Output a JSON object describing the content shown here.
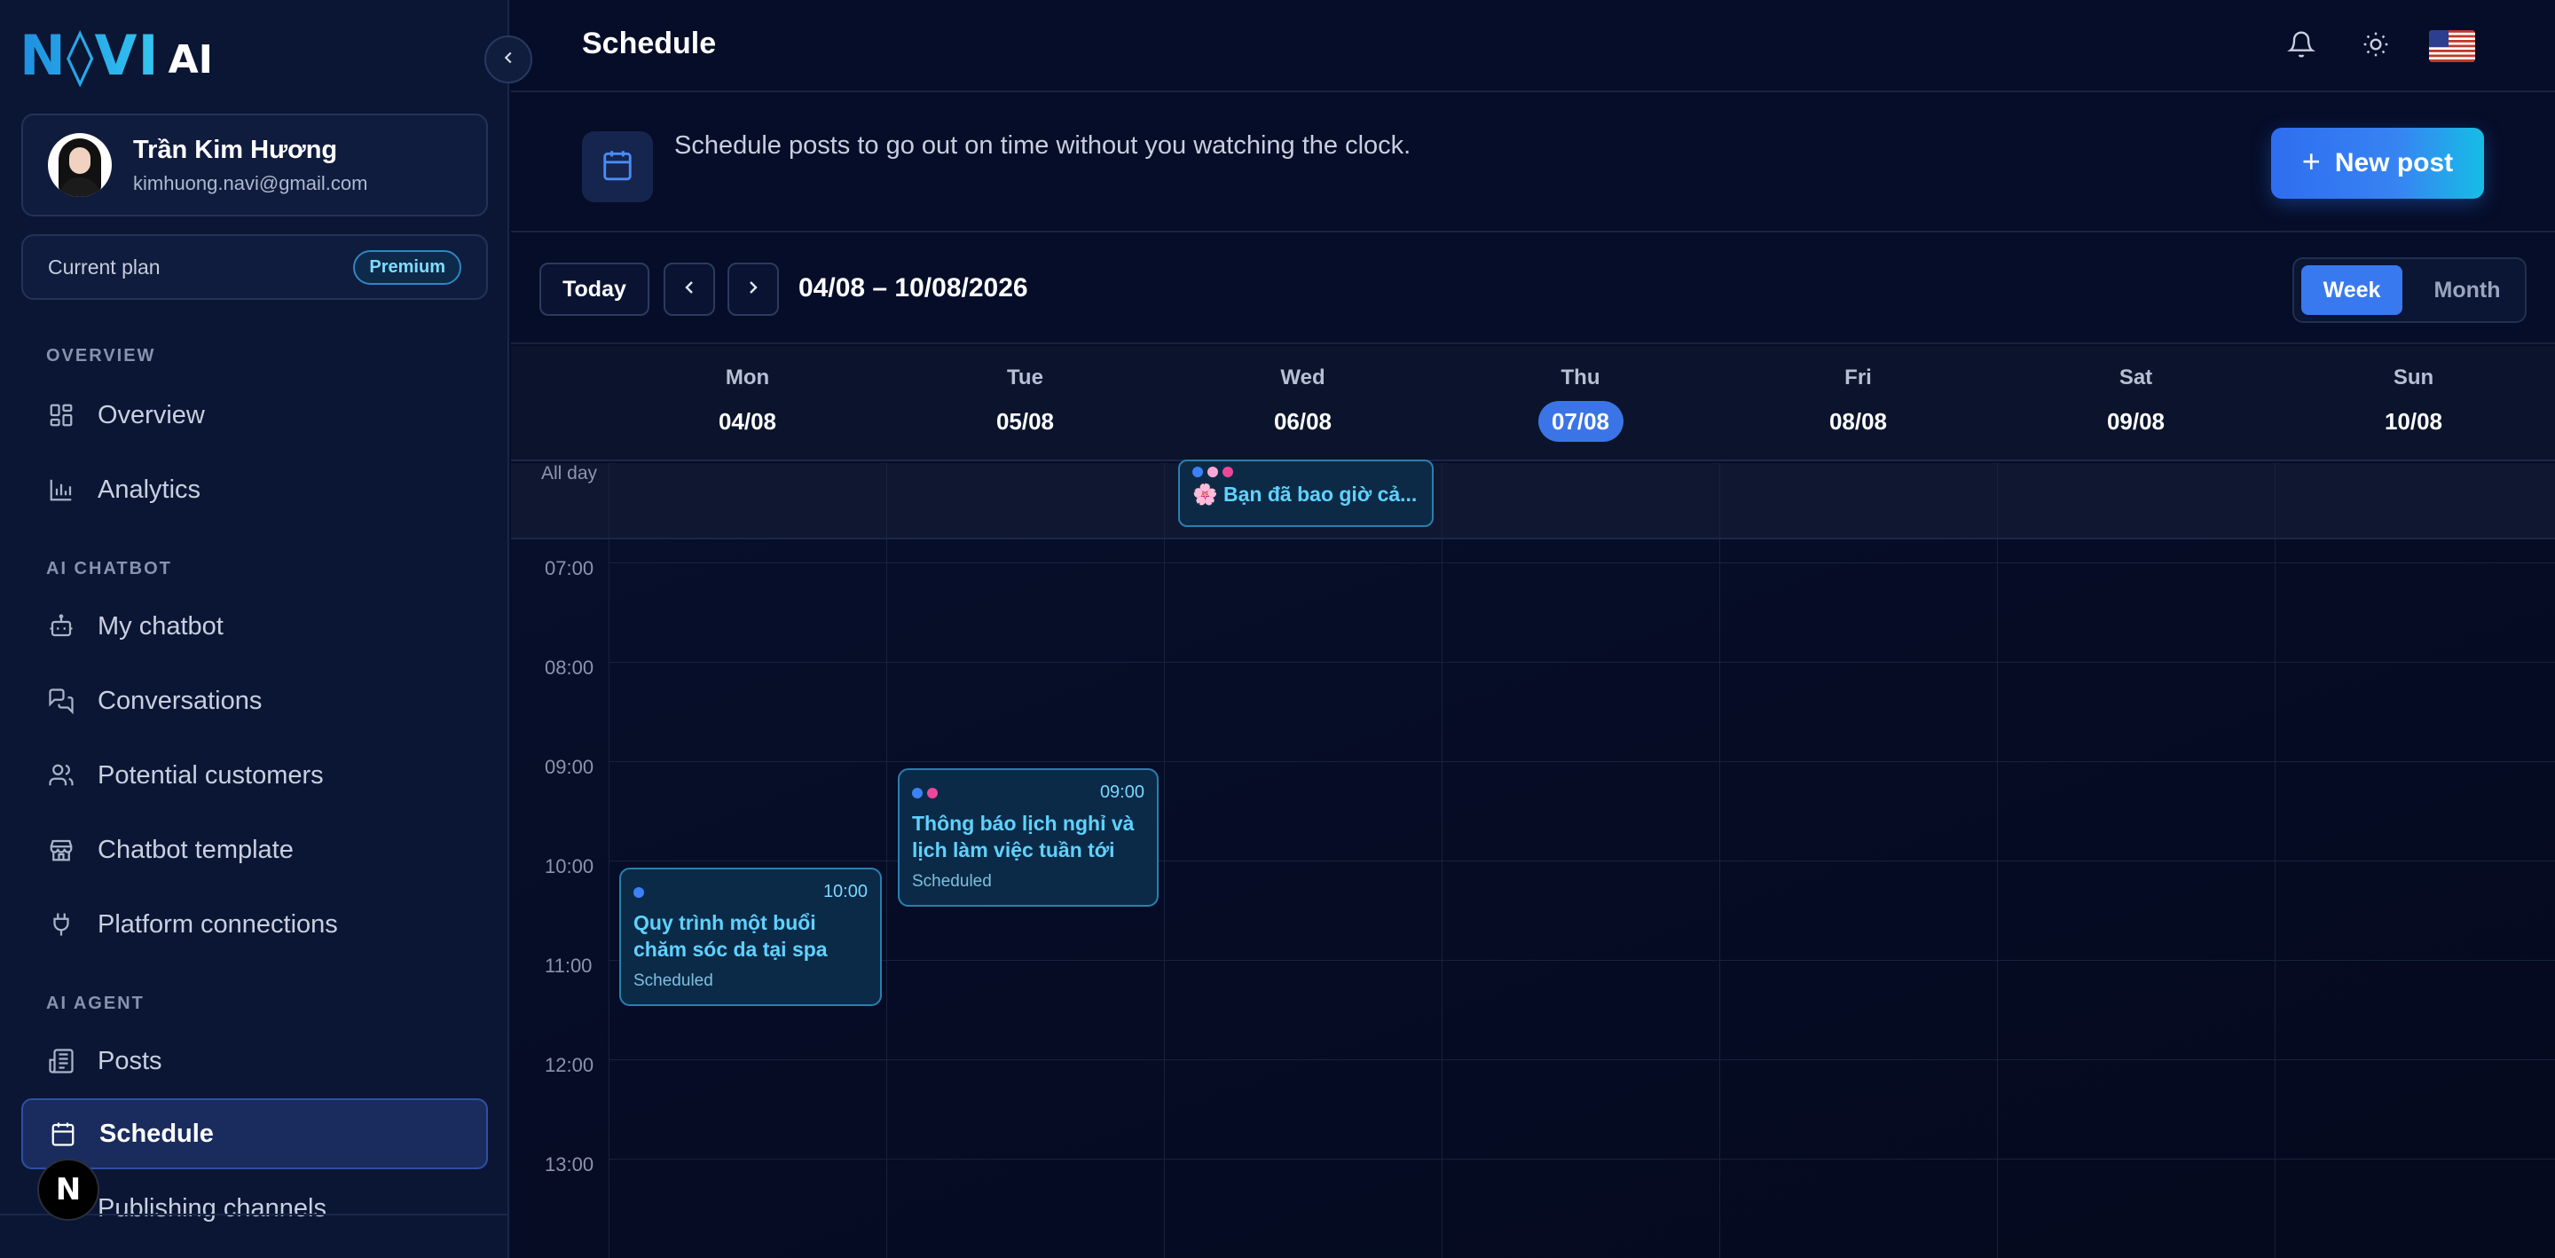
{
  "brand": {
    "logo_text": "N◊VI",
    "logo_suffix": "AI"
  },
  "user": {
    "name": "Trần Kim Hương",
    "email": "kimhuong.navi@gmail.com"
  },
  "plan": {
    "label": "Current plan",
    "badge": "Premium"
  },
  "sidebar": {
    "sections": [
      {
        "title": "OVERVIEW"
      },
      {
        "title": "AI CHATBOT"
      },
      {
        "title": "AI AGENT"
      }
    ],
    "items": [
      {
        "label": "Overview",
        "icon": "grid-icon"
      },
      {
        "label": "Analytics",
        "icon": "bar-chart-icon"
      },
      {
        "label": "My chatbot",
        "icon": "bot-icon"
      },
      {
        "label": "Conversations",
        "icon": "chat-icon"
      },
      {
        "label": "Potential customers",
        "icon": "users-icon"
      },
      {
        "label": "Chatbot template",
        "icon": "store-icon"
      },
      {
        "label": "Platform connections",
        "icon": "plug-icon"
      },
      {
        "label": "Posts",
        "icon": "newspaper-icon"
      },
      {
        "label": "Schedule",
        "icon": "calendar-icon",
        "active": true
      },
      {
        "label": "Publishing channels",
        "icon": "channel-icon"
      }
    ],
    "n_badge": "N"
  },
  "header": {
    "title": "Schedule"
  },
  "banner": {
    "text": "Schedule posts to go out on time without you watching the clock.",
    "new_post_label": "New post",
    "new_post_plus": "+"
  },
  "toolbar": {
    "today_label": "Today",
    "date_range": "04/08 – 10/08/2026",
    "views": [
      "Week",
      "Month"
    ],
    "active_view": "Week"
  },
  "calendar": {
    "days": [
      {
        "name": "Mon",
        "date": "04/08"
      },
      {
        "name": "Tue",
        "date": "05/08"
      },
      {
        "name": "Wed",
        "date": "06/08"
      },
      {
        "name": "Thu",
        "date": "07/08",
        "today": true
      },
      {
        "name": "Fri",
        "date": "08/08"
      },
      {
        "name": "Sat",
        "date": "09/08"
      },
      {
        "name": "Sun",
        "date": "10/08"
      }
    ],
    "all_day_label": "All day",
    "all_day_event": {
      "emoji": "🌸",
      "title": "Bạn đã bao giờ cả...",
      "dot_colors": [
        "#3b82f6",
        "#f9a8d4",
        "#ec4899"
      ]
    },
    "hours": [
      "07:00",
      "08:00",
      "09:00",
      "10:00",
      "11:00",
      "12:00",
      "13:00"
    ],
    "events": [
      {
        "day": "Mon",
        "time": "10:00",
        "title": "Quy trình một buổi chăm sóc da tại spa",
        "status": "Scheduled",
        "dot_colors": [
          "#3b82f6"
        ]
      },
      {
        "day": "Tue",
        "time": "09:00",
        "title": "Thông báo lịch nghỉ và lịch làm việc tuần tới",
        "status": "Scheduled",
        "dot_colors": [
          "#3b82f6",
          "#ec4899"
        ]
      }
    ]
  },
  "colors": {
    "accent": "#3979f0",
    "event_text": "#5fd2ff",
    "background": "#060d28"
  }
}
